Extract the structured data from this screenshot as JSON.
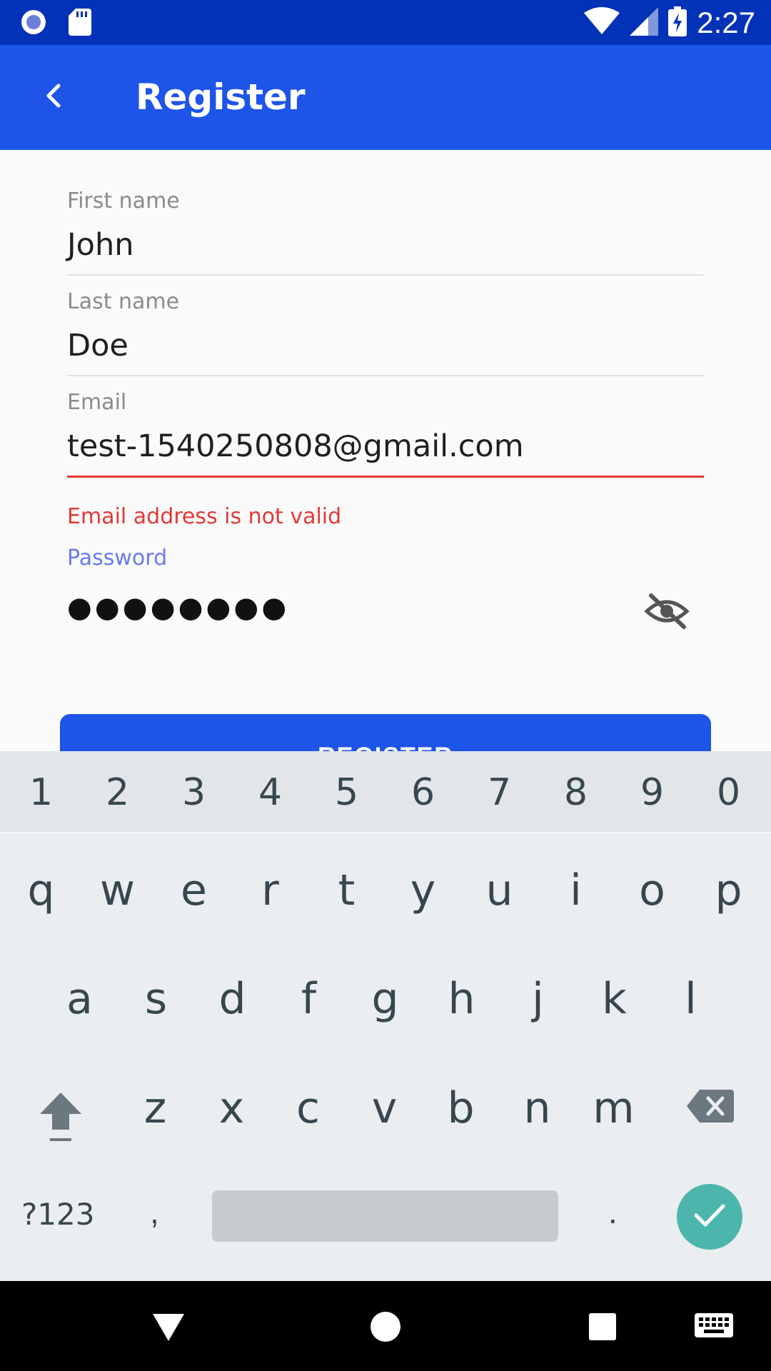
{
  "status_bar": {
    "time": "2:27",
    "icons": [
      "record-icon",
      "sd-card-icon",
      "wifi-icon",
      "signal-icon",
      "battery-charging-icon"
    ]
  },
  "app_bar": {
    "title": "Register",
    "back_icon": "back-arrow-icon"
  },
  "form": {
    "first_name": {
      "label": "First name",
      "value": "John"
    },
    "last_name": {
      "label": "Last name",
      "value": "Doe"
    },
    "email": {
      "label": "Email",
      "value": "test-1540250808@gmail.com",
      "error": "Email address is not valid"
    },
    "password": {
      "label": "Password",
      "value": "●●●●●●●●",
      "toggle_icon": "visibility-off-icon"
    },
    "register_button": {
      "label": "REGISTER"
    }
  },
  "keyboard": {
    "number_row": [
      "1",
      "2",
      "3",
      "4",
      "5",
      "6",
      "7",
      "8",
      "9",
      "0"
    ],
    "row1": [
      "q",
      "w",
      "e",
      "r",
      "t",
      "y",
      "u",
      "i",
      "o",
      "p"
    ],
    "row2": [
      "a",
      "s",
      "d",
      "f",
      "g",
      "h",
      "j",
      "k",
      "l"
    ],
    "row3": [
      "z",
      "x",
      "c",
      "v",
      "b",
      "n",
      "m"
    ],
    "symbols_label": "?123",
    "comma": ",",
    "period": ".",
    "done_icon": "check-icon"
  },
  "colors": {
    "status_bar": "#0232b8",
    "app_bar": "#1e55e8",
    "error": "#e53935",
    "focus": "#6a7bf0",
    "done_key": "#4db6ac"
  }
}
